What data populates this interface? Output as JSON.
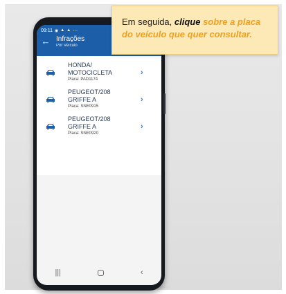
{
  "callout": {
    "part1": "Em seguida, ",
    "part2": "clique",
    "part3": " sobre a placa do veículo que quer consultar."
  },
  "status_bar": {
    "time": "09:11",
    "more": "···"
  },
  "app_bar": {
    "title": "Infrações",
    "subtitle": "Por Veículo"
  },
  "vehicles": [
    {
      "line1": "HONDA/",
      "line2": "MOTOCICLETA",
      "plate": "Placa: PAD1174"
    },
    {
      "line1": "PEUGEOT/208",
      "line2": "GRIFFE A",
      "plate": "Placa: SNE0915"
    },
    {
      "line1": "PEUGEOT/208",
      "line2": "GRIFFE A",
      "plate": "Placa: SNE0920"
    }
  ],
  "colors": {
    "app_bar": "#1c5fa8",
    "accent": "#3b7fd0",
    "callout_bg": "#fde9b6",
    "highlight": "#f0a020"
  },
  "icons": {
    "back": "arrow-left-icon",
    "vehicle": "car-icon",
    "chevron": "chevron-right-icon"
  }
}
